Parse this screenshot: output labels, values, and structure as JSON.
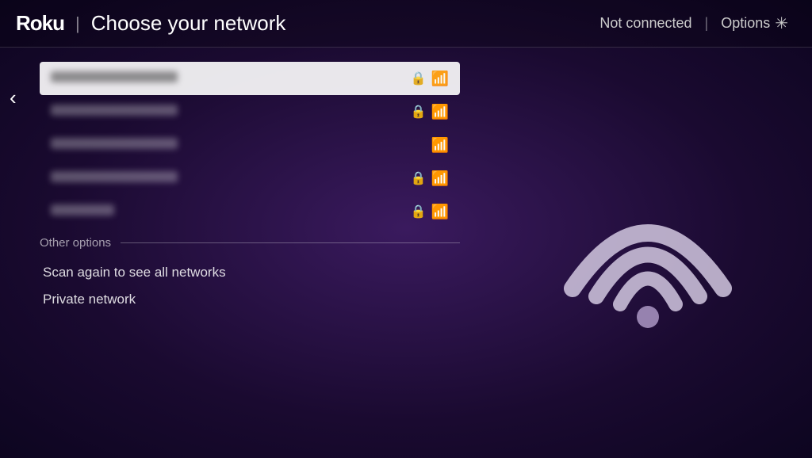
{
  "header": {
    "logo": "Roku",
    "divider": "|",
    "title": "Choose your network",
    "status": "Not connected",
    "status_divider": "|",
    "options_label": "Options",
    "options_icon": "✳"
  },
  "back_button": "‹",
  "networks": [
    {
      "id": "net-1",
      "selected": true,
      "has_lock": true,
      "has_wifi": true
    },
    {
      "id": "net-2",
      "selected": false,
      "has_lock": true,
      "has_wifi": true
    },
    {
      "id": "net-3",
      "selected": false,
      "has_lock": false,
      "has_wifi": true
    },
    {
      "id": "net-4",
      "selected": false,
      "has_lock": true,
      "has_wifi": true
    },
    {
      "id": "net-5",
      "selected": false,
      "has_lock": true,
      "has_wifi": true
    }
  ],
  "other_options": {
    "label": "Other options",
    "items": [
      {
        "id": "scan-again",
        "label": "Scan again to see all networks"
      },
      {
        "id": "private-network",
        "label": "Private network"
      }
    ]
  },
  "wifi_graphic": {
    "aria_label": "WiFi signal graphic"
  }
}
